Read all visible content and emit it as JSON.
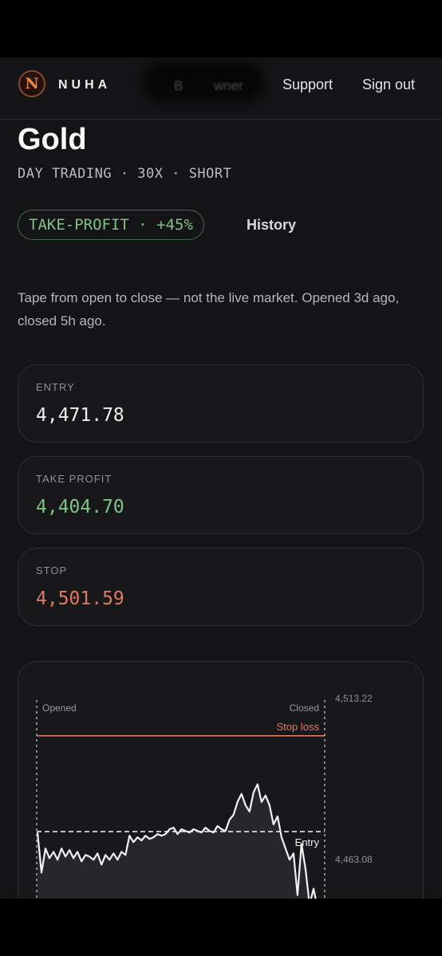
{
  "nav": {
    "logo_letter": "N",
    "brand": "NUHA",
    "blurred_left": "B",
    "blurred_right": "wner",
    "support": "Support",
    "sign_out": "Sign out"
  },
  "trade": {
    "title": "Gold",
    "subtitle": "DAY TRADING · 30X · SHORT",
    "outcome_badge": "TAKE-PROFIT · +45%",
    "history_link": "History",
    "description": "Tape from open to close — not the live market. Opened 3d ago, closed 5h ago."
  },
  "levels": {
    "entry": {
      "label": "ENTRY",
      "value": "4,471.78"
    },
    "take_profit": {
      "label": "TAKE PROFIT",
      "value": "4,404.70"
    },
    "stop": {
      "label": "STOP",
      "value": "4,501.59"
    }
  },
  "colors": {
    "profit": "#7dc484",
    "loss": "#e07a5f",
    "line": "#f2f2f2"
  },
  "chart_data": {
    "type": "line",
    "y_tick_labels": [
      "4,513.22",
      "4,463.08"
    ],
    "ylim": [
      4447,
      4513.22
    ],
    "markers": {
      "opened": "Opened",
      "closed": "Closed"
    },
    "reference_lines": [
      {
        "label": "Stop loss",
        "value": 4501.59
      },
      {
        "label": "Entry",
        "value": 4471.78
      }
    ],
    "series": [
      {
        "values": [
          4471.5,
          4459.0,
          4466.5,
          4463.5,
          4465.5,
          4463.0,
          4466.5,
          4464.0,
          4466.0,
          4463.5,
          4465.5,
          4462.5,
          4464.5,
          4464.0,
          4463.0,
          4465.0,
          4461.5,
          4464.5,
          4463.0,
          4465.0,
          4463.0,
          4465.5,
          4464.5,
          4470.5,
          4468.5,
          4470.0,
          4469.0,
          4470.5,
          4469.5,
          4470.0,
          4471.0,
          4470.5,
          4471.0,
          4472.5,
          4473.0,
          4471.0,
          4472.5,
          4472.0,
          4471.5,
          4472.5,
          4472.0,
          4471.5,
          4473.0,
          4472.0,
          4471.5,
          4473.5,
          4472.5,
          4472.0,
          4475.5,
          4477.0,
          4481.0,
          4483.5,
          4480.0,
          4478.0,
          4484.0,
          4486.5,
          4481.0,
          4483.0,
          4480.0,
          4474.0,
          4476.5,
          4470.0,
          4466.5,
          4463.0,
          4465.0,
          4452.0,
          4468.0,
          4460.0,
          4449.0,
          4454.0,
          4448.0
        ]
      }
    ]
  }
}
